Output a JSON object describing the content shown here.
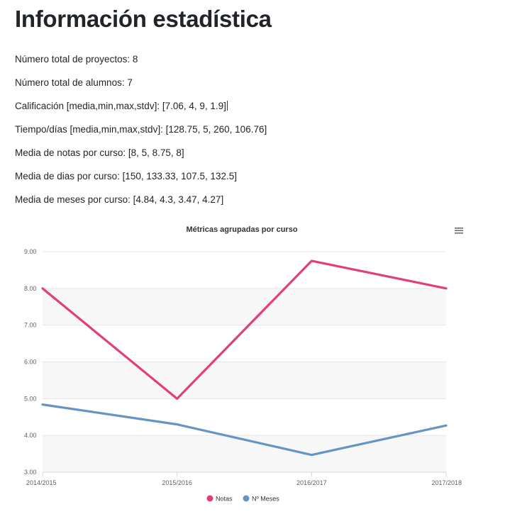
{
  "page": {
    "title": "Información estadística"
  },
  "stats": [
    {
      "label": "Número total de proyectos:",
      "value": "8"
    },
    {
      "label": "Número total de alumnos:",
      "value": "7"
    },
    {
      "label": "Calificación [media,min,max,stdv]:",
      "value": "[7.06, 4, 9, 1.9]"
    },
    {
      "label": "Tiempo/días [media,min,max,stdv]:",
      "value": "[128.75, 5, 260, 106.76]"
    },
    {
      "label": "Media de notas por curso:",
      "value": "[8, 5, 8.75, 8]"
    },
    {
      "label": "Media de dias por curso:",
      "value": "[150, 133.33, 107.5, 132.5]"
    },
    {
      "label": "Media de meses por curso:",
      "value": "[4.84, 4.3, 3.47, 4.27]"
    }
  ],
  "chart_data": {
    "type": "line",
    "title": "Métricas agrupadas por curso",
    "categories": [
      "2014/2015",
      "2015/2016",
      "2016/2017",
      "2017/2018"
    ],
    "series": [
      {
        "name": "Notas",
        "values": [
          8,
          5,
          8.75,
          8
        ],
        "color": "#e23e7c"
      },
      {
        "name": "Nº Meses",
        "values": [
          4.84,
          4.3,
          3.47,
          4.27
        ],
        "color": "#6495c4"
      }
    ],
    "ylim": [
      3,
      9
    ],
    "yticks": [
      "3.00",
      "4.00",
      "5.00",
      "6.00",
      "7.00",
      "8.00",
      "9.00"
    ],
    "grid": true,
    "banded_background": true,
    "legend_position": "bottom-center",
    "menu_icon": "hamburger-menu-icon"
  }
}
